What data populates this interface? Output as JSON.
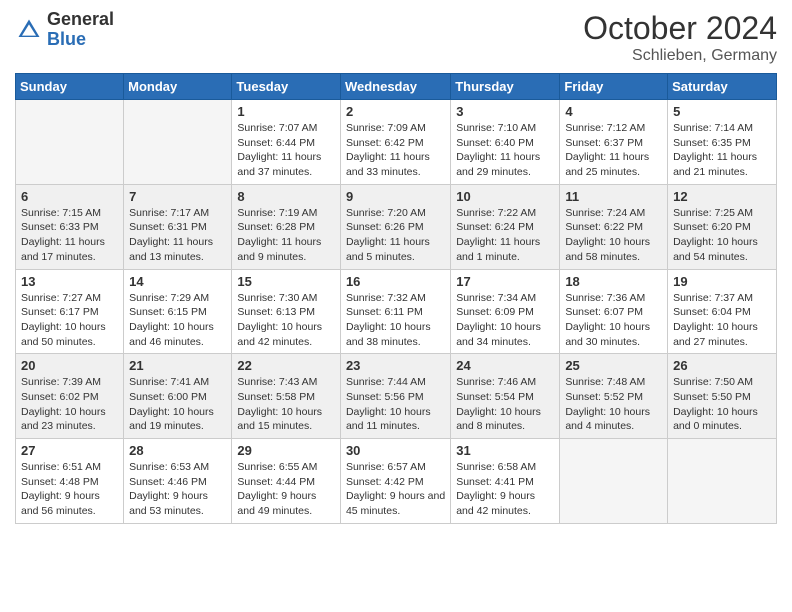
{
  "header": {
    "logo": {
      "general": "General",
      "blue": "Blue"
    },
    "month": "October 2024",
    "location": "Schlieben, Germany"
  },
  "days_of_week": [
    "Sunday",
    "Monday",
    "Tuesday",
    "Wednesday",
    "Thursday",
    "Friday",
    "Saturday"
  ],
  "weeks": [
    [
      {
        "day": "",
        "sunrise": "",
        "sunset": "",
        "daylight": ""
      },
      {
        "day": "",
        "sunrise": "",
        "sunset": "",
        "daylight": ""
      },
      {
        "day": "1",
        "sunrise": "Sunrise: 7:07 AM",
        "sunset": "Sunset: 6:44 PM",
        "daylight": "Daylight: 11 hours and 37 minutes."
      },
      {
        "day": "2",
        "sunrise": "Sunrise: 7:09 AM",
        "sunset": "Sunset: 6:42 PM",
        "daylight": "Daylight: 11 hours and 33 minutes."
      },
      {
        "day": "3",
        "sunrise": "Sunrise: 7:10 AM",
        "sunset": "Sunset: 6:40 PM",
        "daylight": "Daylight: 11 hours and 29 minutes."
      },
      {
        "day": "4",
        "sunrise": "Sunrise: 7:12 AM",
        "sunset": "Sunset: 6:37 PM",
        "daylight": "Daylight: 11 hours and 25 minutes."
      },
      {
        "day": "5",
        "sunrise": "Sunrise: 7:14 AM",
        "sunset": "Sunset: 6:35 PM",
        "daylight": "Daylight: 11 hours and 21 minutes."
      }
    ],
    [
      {
        "day": "6",
        "sunrise": "Sunrise: 7:15 AM",
        "sunset": "Sunset: 6:33 PM",
        "daylight": "Daylight: 11 hours and 17 minutes."
      },
      {
        "day": "7",
        "sunrise": "Sunrise: 7:17 AM",
        "sunset": "Sunset: 6:31 PM",
        "daylight": "Daylight: 11 hours and 13 minutes."
      },
      {
        "day": "8",
        "sunrise": "Sunrise: 7:19 AM",
        "sunset": "Sunset: 6:28 PM",
        "daylight": "Daylight: 11 hours and 9 minutes."
      },
      {
        "day": "9",
        "sunrise": "Sunrise: 7:20 AM",
        "sunset": "Sunset: 6:26 PM",
        "daylight": "Daylight: 11 hours and 5 minutes."
      },
      {
        "day": "10",
        "sunrise": "Sunrise: 7:22 AM",
        "sunset": "Sunset: 6:24 PM",
        "daylight": "Daylight: 11 hours and 1 minute."
      },
      {
        "day": "11",
        "sunrise": "Sunrise: 7:24 AM",
        "sunset": "Sunset: 6:22 PM",
        "daylight": "Daylight: 10 hours and 58 minutes."
      },
      {
        "day": "12",
        "sunrise": "Sunrise: 7:25 AM",
        "sunset": "Sunset: 6:20 PM",
        "daylight": "Daylight: 10 hours and 54 minutes."
      }
    ],
    [
      {
        "day": "13",
        "sunrise": "Sunrise: 7:27 AM",
        "sunset": "Sunset: 6:17 PM",
        "daylight": "Daylight: 10 hours and 50 minutes."
      },
      {
        "day": "14",
        "sunrise": "Sunrise: 7:29 AM",
        "sunset": "Sunset: 6:15 PM",
        "daylight": "Daylight: 10 hours and 46 minutes."
      },
      {
        "day": "15",
        "sunrise": "Sunrise: 7:30 AM",
        "sunset": "Sunset: 6:13 PM",
        "daylight": "Daylight: 10 hours and 42 minutes."
      },
      {
        "day": "16",
        "sunrise": "Sunrise: 7:32 AM",
        "sunset": "Sunset: 6:11 PM",
        "daylight": "Daylight: 10 hours and 38 minutes."
      },
      {
        "day": "17",
        "sunrise": "Sunrise: 7:34 AM",
        "sunset": "Sunset: 6:09 PM",
        "daylight": "Daylight: 10 hours and 34 minutes."
      },
      {
        "day": "18",
        "sunrise": "Sunrise: 7:36 AM",
        "sunset": "Sunset: 6:07 PM",
        "daylight": "Daylight: 10 hours and 30 minutes."
      },
      {
        "day": "19",
        "sunrise": "Sunrise: 7:37 AM",
        "sunset": "Sunset: 6:04 PM",
        "daylight": "Daylight: 10 hours and 27 minutes."
      }
    ],
    [
      {
        "day": "20",
        "sunrise": "Sunrise: 7:39 AM",
        "sunset": "Sunset: 6:02 PM",
        "daylight": "Daylight: 10 hours and 23 minutes."
      },
      {
        "day": "21",
        "sunrise": "Sunrise: 7:41 AM",
        "sunset": "Sunset: 6:00 PM",
        "daylight": "Daylight: 10 hours and 19 minutes."
      },
      {
        "day": "22",
        "sunrise": "Sunrise: 7:43 AM",
        "sunset": "Sunset: 5:58 PM",
        "daylight": "Daylight: 10 hours and 15 minutes."
      },
      {
        "day": "23",
        "sunrise": "Sunrise: 7:44 AM",
        "sunset": "Sunset: 5:56 PM",
        "daylight": "Daylight: 10 hours and 11 minutes."
      },
      {
        "day": "24",
        "sunrise": "Sunrise: 7:46 AM",
        "sunset": "Sunset: 5:54 PM",
        "daylight": "Daylight: 10 hours and 8 minutes."
      },
      {
        "day": "25",
        "sunrise": "Sunrise: 7:48 AM",
        "sunset": "Sunset: 5:52 PM",
        "daylight": "Daylight: 10 hours and 4 minutes."
      },
      {
        "day": "26",
        "sunrise": "Sunrise: 7:50 AM",
        "sunset": "Sunset: 5:50 PM",
        "daylight": "Daylight: 10 hours and 0 minutes."
      }
    ],
    [
      {
        "day": "27",
        "sunrise": "Sunrise: 6:51 AM",
        "sunset": "Sunset: 4:48 PM",
        "daylight": "Daylight: 9 hours and 56 minutes."
      },
      {
        "day": "28",
        "sunrise": "Sunrise: 6:53 AM",
        "sunset": "Sunset: 4:46 PM",
        "daylight": "Daylight: 9 hours and 53 minutes."
      },
      {
        "day": "29",
        "sunrise": "Sunrise: 6:55 AM",
        "sunset": "Sunset: 4:44 PM",
        "daylight": "Daylight: 9 hours and 49 minutes."
      },
      {
        "day": "30",
        "sunrise": "Sunrise: 6:57 AM",
        "sunset": "Sunset: 4:42 PM",
        "daylight": "Daylight: 9 hours and 45 minutes."
      },
      {
        "day": "31",
        "sunrise": "Sunrise: 6:58 AM",
        "sunset": "Sunset: 4:41 PM",
        "daylight": "Daylight: 9 hours and 42 minutes."
      },
      {
        "day": "",
        "sunrise": "",
        "sunset": "",
        "daylight": ""
      },
      {
        "day": "",
        "sunrise": "",
        "sunset": "",
        "daylight": ""
      }
    ]
  ]
}
